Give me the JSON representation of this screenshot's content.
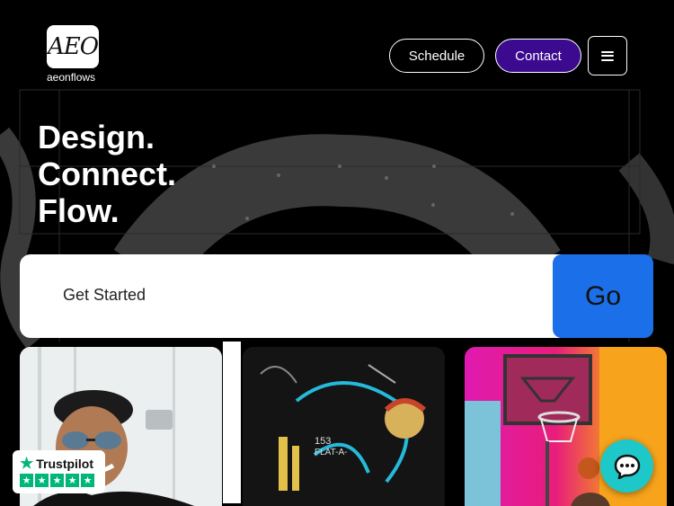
{
  "brand": {
    "logo_mark": "AEO",
    "name": "aeonflows"
  },
  "nav": {
    "schedule_label": "Schedule",
    "contact_label": "Contact",
    "menu_icon": "hamburger-menu-icon"
  },
  "hero": {
    "lines": [
      "Design.",
      "Connect.",
      "Flow."
    ]
  },
  "cta": {
    "label": "Get Started",
    "button_label": "Go"
  },
  "cards": [
    {
      "subject": "portrait-photo"
    },
    {
      "subject": "graffiti-photo"
    },
    {
      "subject": "basketball-hoop-photo"
    }
  ],
  "trustpilot": {
    "label": "Trustpilot",
    "stars": 5
  },
  "chat": {
    "icon": "chat-bubble-icon"
  },
  "colors": {
    "contact_bg": "#3b0a8f",
    "go_bg": "#1b6fe8",
    "chat_bg": "#1ec8c8",
    "trustpilot_green": "#00b67a"
  }
}
